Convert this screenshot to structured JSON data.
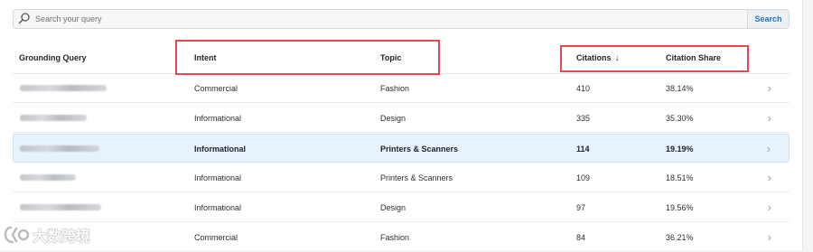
{
  "search": {
    "placeholder": "Search your query",
    "button_label": "Search"
  },
  "table": {
    "columns": {
      "query": "Grounding Query",
      "intent": "Intent",
      "topic": "Topic",
      "citations": "Citations",
      "citations_sort": "↓",
      "share": "Citation Share"
    },
    "rows": [
      {
        "intent": "Commercial",
        "topic": "Fashion",
        "citations": "410",
        "share": "38.14%"
      },
      {
        "intent": "Informational",
        "topic": "Design",
        "citations": "335",
        "share": "35.30%"
      },
      {
        "intent": "Informational",
        "topic": "Printers & Scanners",
        "citations": "114",
        "share": "19.19%"
      },
      {
        "intent": "Informational",
        "topic": "Printers & Scanners",
        "citations": "109",
        "share": "18.51%"
      },
      {
        "intent": "Informational",
        "topic": "Design",
        "citations": "97",
        "share": "19.56%"
      },
      {
        "intent": "Commercial",
        "topic": "Fashion",
        "citations": "84",
        "share": "36.21%"
      }
    ]
  },
  "watermark": {
    "text": "大数跨境"
  },
  "colors": {
    "accent": "#1f6fc5",
    "highlight_box": "#e5484d",
    "selected_row": "#e8f2fd"
  }
}
